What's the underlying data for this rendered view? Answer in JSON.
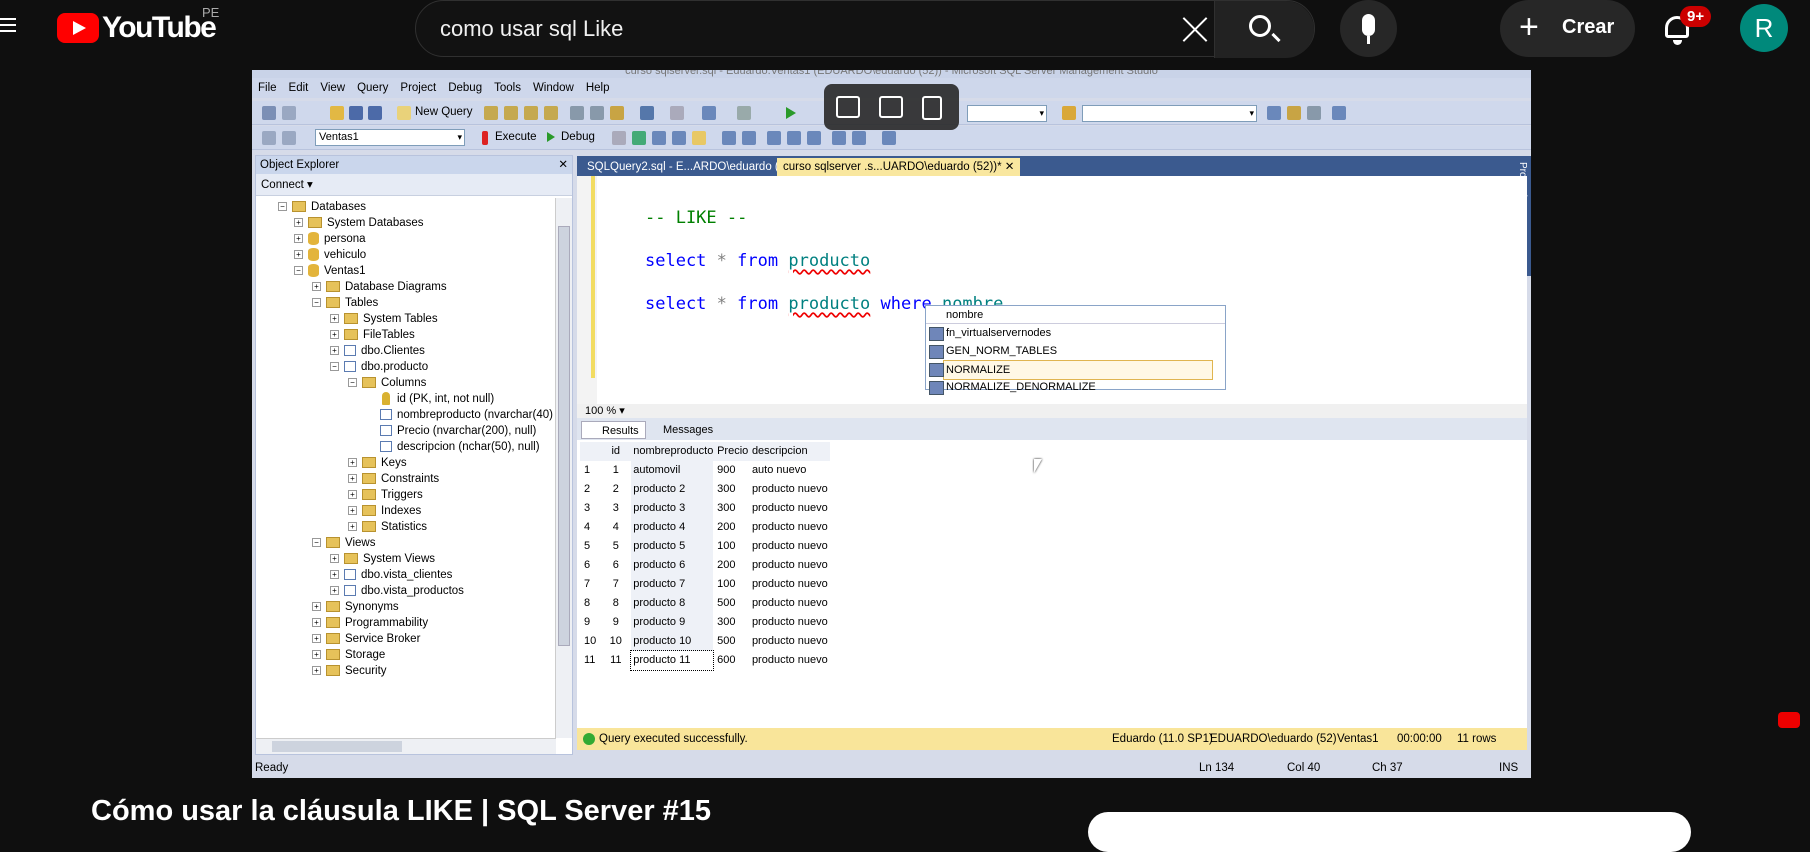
{
  "youtube": {
    "logo": "YouTube",
    "country": "PE",
    "search": {
      "query": "como usar sql Like"
    },
    "create_label": "Crear",
    "notif_count": "9+",
    "avatar_letter": "R",
    "video_title": "Cómo usar la cláusula LIKE | SQL Server #15"
  },
  "ssms": {
    "title": "curso sqlserver.sql - Eduardo.Ventas1 (EDUARDO\\eduardo (52)) - Microsoft SQL Server Management Studio",
    "menu": [
      "File",
      "Edit",
      "View",
      "Query",
      "Project",
      "Debug",
      "Tools",
      "Window",
      "Help"
    ],
    "toolbar": {
      "new_query": "New Query",
      "database": "Ventas1",
      "execute": "Execute",
      "debug": "Debug"
    },
    "object_explorer": {
      "title": "Object Explorer",
      "connect": "Connect",
      "nodes": [
        "Databases",
        "System Databases",
        "persona",
        "vehiculo",
        "Ventas1",
        "Database Diagrams",
        "Tables",
        "System Tables",
        "FileTables",
        "dbo.Clientes",
        "dbo.producto",
        "Columns",
        "id (PK, int, not null)",
        "nombreproducto (nvarchar(40)",
        "Precio (nvarchar(200), null)",
        "descripcion (nchar(50), null)",
        "Keys",
        "Constraints",
        "Triggers",
        "Indexes",
        "Statistics",
        "Views",
        "System Views",
        "dbo.vista_clientes",
        "dbo.vista_productos",
        "Synonyms",
        "Programmability",
        "Service Broker",
        "Storage",
        "Security"
      ]
    },
    "tabs": [
      "SQLQuery2.sql - E...ARDO\\eduardo (53))",
      "curso sqlserver .s...UARDO\\eduardo (52))*"
    ],
    "editor": {
      "comment": "-- LIKE --",
      "kw_select": "select",
      "star": "*",
      "kw_from": "from",
      "table": "producto",
      "kw_where": "where",
      "column": "nombre"
    },
    "autocomplete": {
      "typed": "nombre",
      "items": [
        "fn_virtualservernodes",
        "GEN_NORM_TABLES",
        "NORMALIZE",
        "NORMALIZE_DENORMALIZE"
      ]
    },
    "zoom": "100 %",
    "result_tabs": [
      "Results",
      "Messages"
    ],
    "results": {
      "columns": [
        "",
        "id",
        "nombreproducto",
        "Precio",
        "descripcion"
      ],
      "rows": [
        [
          "1",
          "1",
          "automovil",
          "900",
          "auto nuevo"
        ],
        [
          "2",
          "2",
          "producto 2",
          "300",
          "producto nuevo"
        ],
        [
          "3",
          "3",
          "producto 3",
          "300",
          "producto nuevo"
        ],
        [
          "4",
          "4",
          "producto 4",
          "200",
          "producto nuevo"
        ],
        [
          "5",
          "5",
          "producto 5",
          "100",
          "producto nuevo"
        ],
        [
          "6",
          "6",
          "producto 6",
          "200",
          "producto nuevo"
        ],
        [
          "7",
          "7",
          "producto 7",
          "100",
          "producto nuevo"
        ],
        [
          "8",
          "8",
          "producto 8",
          "500",
          "producto nuevo"
        ],
        [
          "9",
          "9",
          "producto 9",
          "300",
          "producto nuevo"
        ],
        [
          "10",
          "10",
          "producto 10",
          "500",
          "producto nuevo"
        ],
        [
          "11",
          "11",
          "producto 11",
          "600",
          "producto nuevo"
        ]
      ]
    },
    "query_status": {
      "message": "Query executed successfully.",
      "server": "Eduardo (11.0 SP1)",
      "user": "EDUARDO\\eduardo (52)",
      "db": "Ventas1",
      "time": "00:00:00",
      "rows": "11 rows"
    },
    "status": {
      "ready": "Ready",
      "ln": "Ln 134",
      "col": "Col 40",
      "ch": "Ch 37",
      "ins": "INS"
    },
    "properties": "Properties"
  }
}
